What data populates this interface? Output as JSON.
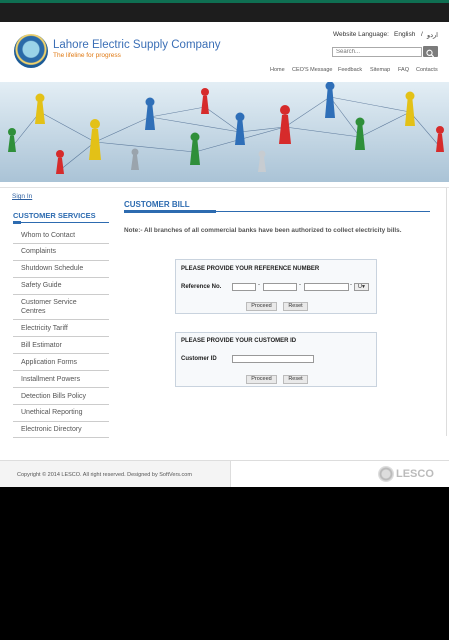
{
  "header": {
    "brand": "Lahore Electric Supply Company",
    "tagline": "The lifeline for progress",
    "language_label": "Website Language:",
    "lang_english": "English",
    "lang_separator": "/",
    "lang_urdu": "اردو",
    "search_placeholder": "Search..."
  },
  "nav": [
    "Home",
    "CEO'S Message",
    "Feedback",
    "Sitemap",
    "FAQ",
    "Contacts"
  ],
  "sign_in": "Sign In",
  "sidebar": {
    "heading": "CUSTOMER SERVICES",
    "items": [
      {
        "label": "Whom to Contact"
      },
      {
        "label": "Complaints"
      },
      {
        "label": "Shutdown Schedule"
      },
      {
        "label": "Safety Guide"
      },
      {
        "label": "Customer Service Centres"
      },
      {
        "label": "Electricity Tariff"
      },
      {
        "label": "Bill Estimator"
      },
      {
        "label": "Application Forms"
      },
      {
        "label": "Installment Powers"
      },
      {
        "label": "Detection Bills Policy"
      },
      {
        "label": "Unethical Reporting"
      },
      {
        "label": "Electronic Directory"
      }
    ]
  },
  "main": {
    "title": "CUSTOMER BILL",
    "note": "Note:- All branches of all commercial banks have been authorized to collect electricity bills.",
    "ref_form": {
      "title": "PLEASE PROVIDE YOUR REFERENCE NUMBER",
      "label": "Reference No.",
      "dash": "-",
      "select_value": "U",
      "proceed": "Proceed",
      "reset": "Reset"
    },
    "cust_form": {
      "title": "PLEASE PROVIDE YOUR CUSTOMER ID",
      "label": "Customer ID",
      "proceed": "Proceed",
      "reset": "Reset"
    }
  },
  "footer": {
    "copyright": "Copyright © 2014 LESCO. All right reserved. Designed by SoftVers.com",
    "logo_text": "LESCO"
  },
  "colors": {
    "accent": "#2d6bb0",
    "brand_orange": "#e07a14",
    "topbar": "#1d1d1d"
  }
}
